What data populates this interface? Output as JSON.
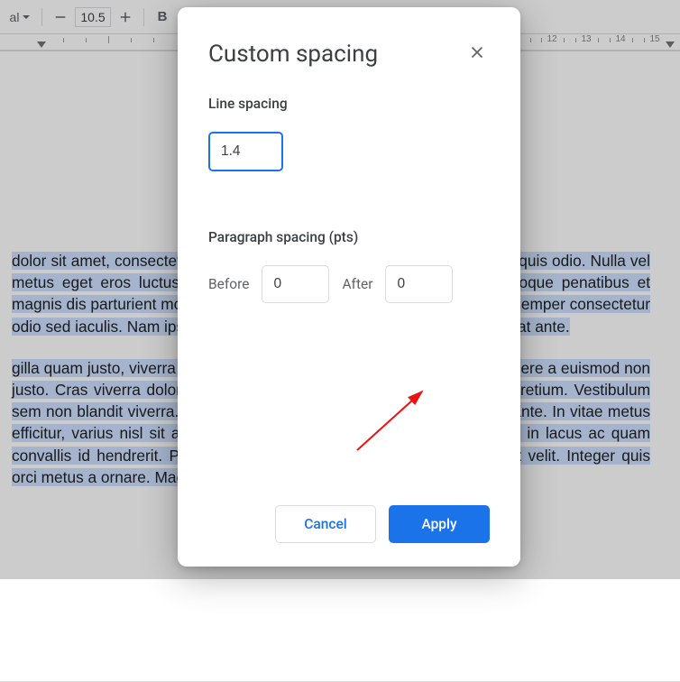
{
  "toolbar": {
    "font_size": "10.5"
  },
  "ruler": {
    "visible_numbers": [
      12,
      13,
      14,
      15
    ]
  },
  "document": {
    "paragraph1": "dolor sit amet, consectetur adipiscing elit. Cras viverra dignissim quis est quis odio. Nulla vel metus eget eros luctus euismod eu augue. Aliquam . Orci varius natoque penatibus et magnis dis parturient montes, nascetur ridiculus tincidunt nibh. Praesent semper consectetur odio sed iaculis. Nam ipsum non euismod lla quis libero consectetur feugiat ante.",
    "paragraph2": "gilla quam justo, viverra congue tortor vitae. Donec sit amet elit erat, posuere a euismod non justo. Cras viverra dolor hendrerit pellentesque. Pellentesque osum id pretium. Vestibulum sem non blandit viverra. Morbi elementum ex fermentum amet tincidunt ante. In vitae metus efficitur, varius nisl sit amet mi efficitur, ultricies , tincidunt enim. Mauris in lacus ac quam convallis id hendrerit. Praesent justo r ac tempor eget, condimentum et velit. Integer quis orci metus a ornare. Maecenas diam iaculis iaculis non tempus nisi."
  },
  "dialog": {
    "title": "Custom spacing",
    "line_spacing_label": "Line spacing",
    "line_spacing_value": "1.4",
    "para_spacing_label": "Paragraph spacing (pts)",
    "before_label": "Before",
    "before_value": "0",
    "after_label": "After",
    "after_value": "0",
    "cancel": "Cancel",
    "apply": "Apply"
  }
}
